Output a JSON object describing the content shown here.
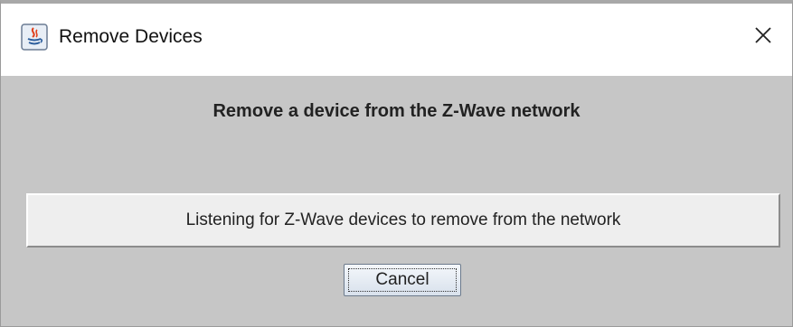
{
  "window": {
    "title": "Remove Devices",
    "app_icon": "java-icon",
    "close_icon": "close-icon"
  },
  "dialog": {
    "heading": "Remove a device from the Z-Wave network",
    "status_message": "Listening for Z-Wave devices to remove from the network",
    "cancel_label": "Cancel"
  },
  "colors": {
    "dialog_background": "#c6c6c6",
    "status_background": "#eeeeee",
    "titlebar_background": "#ffffff"
  }
}
